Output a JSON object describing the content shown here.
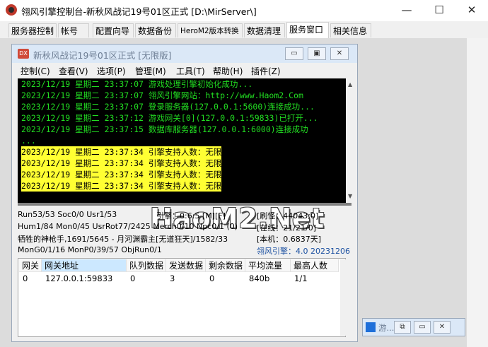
{
  "window": {
    "title": "翎风引擎控制台-新秋风战记19号01区正式 [D:\\MirServer\\]",
    "minimize": "—",
    "maximize": "☐",
    "close": "✕"
  },
  "tabs": [
    {
      "label": "服务器控制"
    },
    {
      "label": "帐号"
    },
    {
      "label": "配置向导"
    },
    {
      "label": "数据备份"
    },
    {
      "label": "HeroM2版本转换"
    },
    {
      "label": "数据清理"
    },
    {
      "label": "服务窗口"
    },
    {
      "label": "相关信息"
    }
  ],
  "child_window": {
    "icon_text": "DX",
    "title": "新秋风战记19号01区正式 [无限版]",
    "min": "▭",
    "max": "▣",
    "close": "✕",
    "menu": [
      {
        "label": "控制(C)"
      },
      {
        "label": "查看(V)"
      },
      {
        "label": "选项(P)"
      },
      {
        "label": "管理(M)"
      },
      {
        "label": "工具(T)"
      },
      {
        "label": "帮助(H)"
      },
      {
        "label": "插件(Z)"
      }
    ]
  },
  "log": [
    {
      "text": "2023/12/19 星期二 23:37:07 游戏处理引擎初始化成功..."
    },
    {
      "text": "2023/12/19 星期二 23:37:07 翎风引擎网站：http://www.Haom2.Com"
    },
    {
      "text": "2023/12/19 星期二 23:37:07 登录服务器(127.0.0.1:5600)连接成功..."
    },
    {
      "text": "2023/12/19 星期二 23:37:12 游戏网关[0](127.0.0.1:59833)已打开..."
    },
    {
      "text": "2023/12/19 星期二 23:37:15 数据库服务器(127.0.0.1:6000)连接成功"
    },
    {
      "text": "..."
    },
    {
      "text": "2023/12/19 星期二 23:37:34 引擎支持人数：无限"
    },
    {
      "text": "2023/12/19 星期二 23:37:34 引擎支持人数：无限"
    },
    {
      "text": "2023/12/19 星期二 23:37:34 引擎支持人数：无限"
    },
    {
      "text": "2023/12/19 星期二 23:37:34 引擎支持人数：无限"
    }
  ],
  "watermark": "HaoM2.Net",
  "status": {
    "run": "Run53/53 Soc0/0 Usr1/53",
    "engine": "引擎：0:6:5 [M][F]",
    "refresh": "[刷怪：44043;0]",
    "hum": "Hum1/84 Mon0/45 UsrRot77/2425 Merch0/10 Npc0/1 (0)",
    "online": "[在线：21/21/0]",
    "player": "牺牲的神枪手,1691/5645 - 月河渊霸主[无道狂天]/1582/33",
    "local": "[本机：0.6837天]",
    "mon": "MonG0/1/16 MonP0/39/57 ObjRun0/1",
    "version": "翎风引擎：4.0 20231206"
  },
  "table": {
    "headers": [
      "网关",
      "网关地址",
      "队列数据",
      "发送数据",
      "剩余数据",
      "平均流量",
      "最高人数"
    ],
    "rows": [
      [
        "0",
        "127.0.0.1:59833",
        "0",
        "3",
        "0",
        "840b",
        "1/1"
      ]
    ]
  },
  "minimized": {
    "title": "游...",
    "restore": "⧉",
    "max": "▭",
    "close": "✕"
  },
  "colors": {
    "log_text": "#22dd22",
    "log_highlight": "#ffff33",
    "version_text": "#1a4fa0"
  }
}
